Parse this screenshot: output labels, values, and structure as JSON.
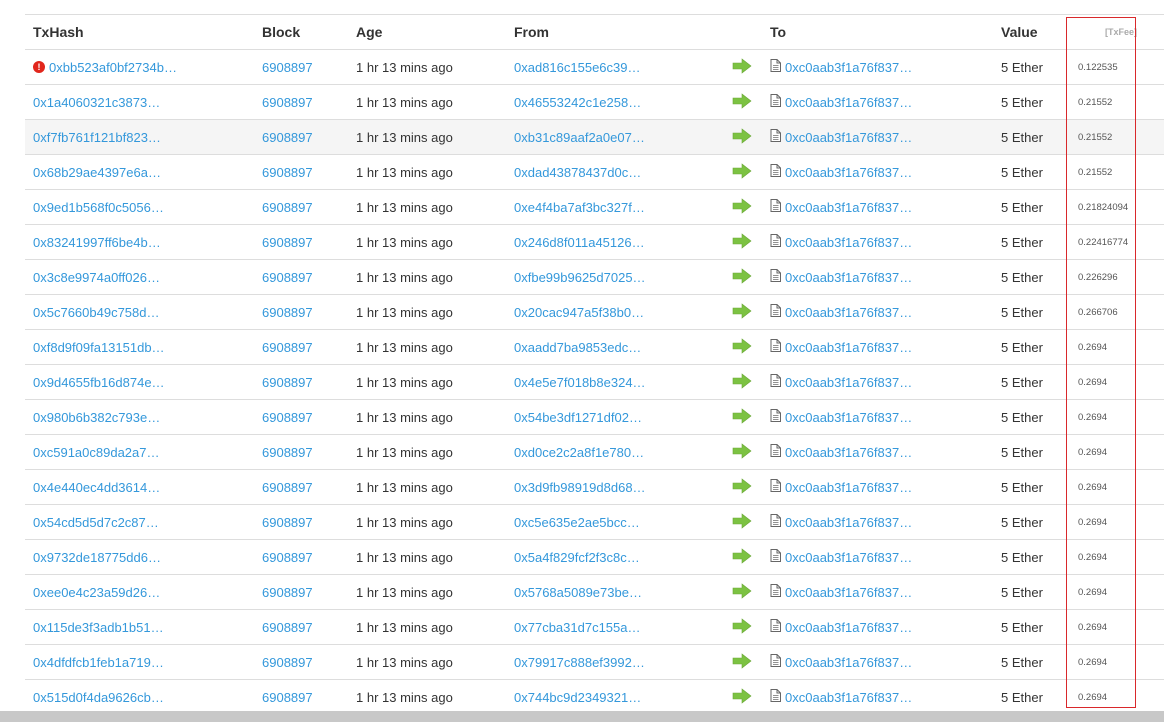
{
  "colors": {
    "link": "#3498db",
    "highlight_box": "#d9282b",
    "arrow": "#7cc242",
    "error": "#e1261c"
  },
  "columns": {
    "txhash": "TxHash",
    "block": "Block",
    "age": "Age",
    "from": "From",
    "to": "To",
    "value": "Value",
    "txfee": "[TxFee]"
  },
  "rows": [
    {
      "hash": "0xbb523af0bf2734b…",
      "error": true,
      "block": "6908897",
      "age": "1 hr 13 mins ago",
      "from": "0xad816c155e6c39…",
      "to": "0xc0aab3f1a76f837…",
      "value": "5 Ether",
      "fee": "0.122535"
    },
    {
      "hash": "0x1a4060321c3873…",
      "error": false,
      "block": "6908897",
      "age": "1 hr 13 mins ago",
      "from": "0x46553242c1e258…",
      "to": "0xc0aab3f1a76f837…",
      "value": "5 Ether",
      "fee": "0.21552"
    },
    {
      "hash": "0xf7fb761f121bf823…",
      "error": false,
      "block": "6908897",
      "age": "1 hr 13 mins ago",
      "from": "0xb31c89aaf2a0e07…",
      "to": "0xc0aab3f1a76f837…",
      "value": "5 Ether",
      "fee": "0.21552"
    },
    {
      "hash": "0x68b29ae4397e6a…",
      "error": false,
      "block": "6908897",
      "age": "1 hr 13 mins ago",
      "from": "0xdad43878437d0c…",
      "to": "0xc0aab3f1a76f837…",
      "value": "5 Ether",
      "fee": "0.21552"
    },
    {
      "hash": "0x9ed1b568f0c5056…",
      "error": false,
      "block": "6908897",
      "age": "1 hr 13 mins ago",
      "from": "0xe4f4ba7af3bc327f…",
      "to": "0xc0aab3f1a76f837…",
      "value": "5 Ether",
      "fee": "0.21824094"
    },
    {
      "hash": "0x83241997ff6be4b…",
      "error": false,
      "block": "6908897",
      "age": "1 hr 13 mins ago",
      "from": "0x246d8f011a45126…",
      "to": "0xc0aab3f1a76f837…",
      "value": "5 Ether",
      "fee": "0.22416774"
    },
    {
      "hash": "0x3c8e9974a0ff026…",
      "error": false,
      "block": "6908897",
      "age": "1 hr 13 mins ago",
      "from": "0xfbe99b9625d7025…",
      "to": "0xc0aab3f1a76f837…",
      "value": "5 Ether",
      "fee": "0.226296"
    },
    {
      "hash": "0x5c7660b49c758d…",
      "error": false,
      "block": "6908897",
      "age": "1 hr 13 mins ago",
      "from": "0x20cac947a5f38b0…",
      "to": "0xc0aab3f1a76f837…",
      "value": "5 Ether",
      "fee": "0.266706"
    },
    {
      "hash": "0xf8d9f09fa13151db…",
      "error": false,
      "block": "6908897",
      "age": "1 hr 13 mins ago",
      "from": "0xaadd7ba9853edc…",
      "to": "0xc0aab3f1a76f837…",
      "value": "5 Ether",
      "fee": "0.2694"
    },
    {
      "hash": "0x9d4655fb16d874e…",
      "error": false,
      "block": "6908897",
      "age": "1 hr 13 mins ago",
      "from": "0x4e5e7f018b8e324…",
      "to": "0xc0aab3f1a76f837…",
      "value": "5 Ether",
      "fee": "0.2694"
    },
    {
      "hash": "0x980b6b382c793e…",
      "error": false,
      "block": "6908897",
      "age": "1 hr 13 mins ago",
      "from": "0x54be3df1271df02…",
      "to": "0xc0aab3f1a76f837…",
      "value": "5 Ether",
      "fee": "0.2694"
    },
    {
      "hash": "0xc591a0c89da2a7…",
      "error": false,
      "block": "6908897",
      "age": "1 hr 13 mins ago",
      "from": "0xd0ce2c2a8f1e780…",
      "to": "0xc0aab3f1a76f837…",
      "value": "5 Ether",
      "fee": "0.2694"
    },
    {
      "hash": "0x4e440ec4dd3614…",
      "error": false,
      "block": "6908897",
      "age": "1 hr 13 mins ago",
      "from": "0x3d9fb98919d8d68…",
      "to": "0xc0aab3f1a76f837…",
      "value": "5 Ether",
      "fee": "0.2694"
    },
    {
      "hash": "0x54cd5d5d7c2c87…",
      "error": false,
      "block": "6908897",
      "age": "1 hr 13 mins ago",
      "from": "0xc5e635e2ae5bcc…",
      "to": "0xc0aab3f1a76f837…",
      "value": "5 Ether",
      "fee": "0.2694"
    },
    {
      "hash": "0x9732de18775dd6…",
      "error": false,
      "block": "6908897",
      "age": "1 hr 13 mins ago",
      "from": "0x5a4f829fcf2f3c8c…",
      "to": "0xc0aab3f1a76f837…",
      "value": "5 Ether",
      "fee": "0.2694"
    },
    {
      "hash": "0xee0e4c23a59d26…",
      "error": false,
      "block": "6908897",
      "age": "1 hr 13 mins ago",
      "from": "0x5768a5089e73be…",
      "to": "0xc0aab3f1a76f837…",
      "value": "5 Ether",
      "fee": "0.2694"
    },
    {
      "hash": "0x115de3f3adb1b51…",
      "error": false,
      "block": "6908897",
      "age": "1 hr 13 mins ago",
      "from": "0x77cba31d7c155a…",
      "to": "0xc0aab3f1a76f837…",
      "value": "5 Ether",
      "fee": "0.2694"
    },
    {
      "hash": "0x4dfdfcb1feb1a719…",
      "error": false,
      "block": "6908897",
      "age": "1 hr 13 mins ago",
      "from": "0x79917c888ef3992…",
      "to": "0xc0aab3f1a76f837…",
      "value": "5 Ether",
      "fee": "0.2694"
    },
    {
      "hash": "0x515d0f4da9626cb…",
      "error": false,
      "block": "6908897",
      "age": "1 hr 13 mins ago",
      "from": "0x744bc9d2349321…",
      "to": "0xc0aab3f1a76f837…",
      "value": "5 Ether",
      "fee": "0.2694"
    }
  ]
}
